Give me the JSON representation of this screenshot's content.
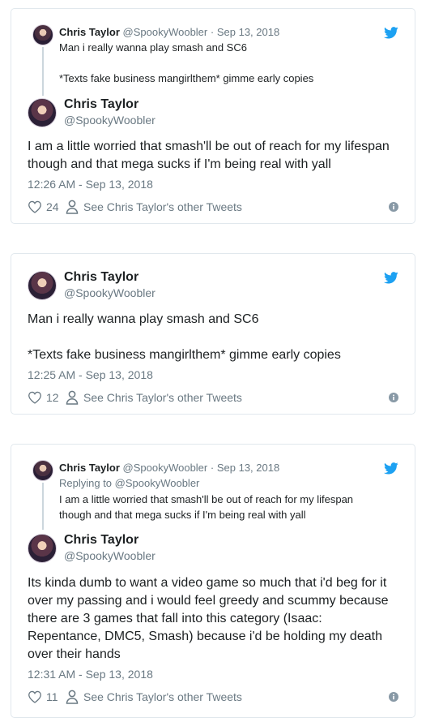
{
  "colors": {
    "border": "#e1e8ed",
    "secondary_text": "#697882",
    "primary_text": "#1c2022",
    "twitter_blue": "#1da1f2",
    "thread_line": "#ccd6dd"
  },
  "cards": [
    {
      "quoted": {
        "name": "Chris Taylor",
        "handle": "@SpookyWoobler",
        "separator": "·",
        "date": "Sep 13, 2018",
        "replying_to": "",
        "text_lines": [
          "Man i really wanna play smash and SC6",
          "",
          "*Texts fake business mangirlthem* gimme early copies"
        ]
      },
      "name": "Chris Taylor",
      "handle": "@SpookyWoobler",
      "text_lines": [
        "I am a little worried that smash'll be out of reach for my lifespan",
        "though and that mega sucks if I'm being real with yall"
      ],
      "timestamp": "12:26 AM - Sep 13, 2018",
      "likes": "24",
      "see_other": "See Chris Taylor's other Tweets"
    },
    {
      "name": "Chris Taylor",
      "handle": "@SpookyWoobler",
      "text_lines": [
        "Man i really wanna play smash and SC6",
        "",
        "*Texts fake business mangirlthem* gimme early copies"
      ],
      "timestamp": "12:25 AM - Sep 13, 2018",
      "likes": "12",
      "see_other": "See Chris Taylor's other Tweets"
    },
    {
      "quoted": {
        "name": "Chris Taylor",
        "handle": "@SpookyWoobler",
        "separator": "·",
        "date": "Sep 13, 2018",
        "replying_to": "Replying to @SpookyWoobler",
        "text_lines": [
          "I am a little worried that smash'll be out of reach for my lifespan",
          "though and that mega sucks if I'm being real with yall"
        ]
      },
      "name": "Chris Taylor",
      "handle": "@SpookyWoobler",
      "text_lines": [
        "Its kinda dumb to want a video game so much that i'd beg for it",
        "over my passing and i would feel greedy and scummy because",
        "there are 3 games that fall into this category (Isaac:",
        "Repentance, DMC5, Smash) because i'd be holding my death",
        "over their hands"
      ],
      "timestamp": "12:31 AM - Sep 13, 2018",
      "likes": "11",
      "see_other": "See Chris Taylor's other Tweets"
    }
  ]
}
